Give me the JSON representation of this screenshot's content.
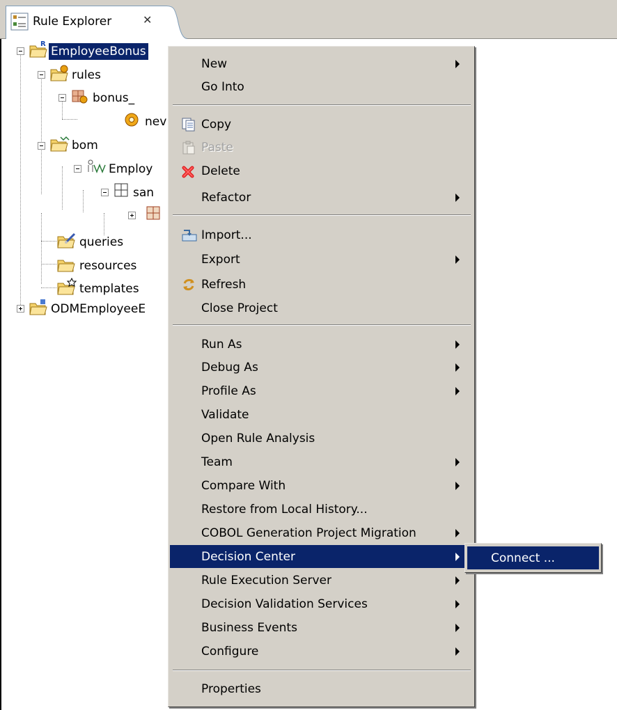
{
  "view": {
    "tab_title": "Rule Explorer",
    "close_glyph": "✕"
  },
  "tree": {
    "nodes": [
      {
        "label": "EmployeeBonus",
        "icon": "rule-project-icon"
      },
      {
        "label": "rules",
        "icon": "rules-folder-icon"
      },
      {
        "label": "bonus_",
        "icon": "ruleflow-package-icon"
      },
      {
        "label": "nev",
        "icon": "rule-gear-icon"
      },
      {
        "label": "bom",
        "icon": "bom-folder-icon"
      },
      {
        "label": "Employ",
        "icon": "bom-entry-icon"
      },
      {
        "label": "san",
        "icon": "package-grid-icon"
      },
      {
        "label": "",
        "icon": "class-grid-icon"
      },
      {
        "label": "queries",
        "icon": "queries-folder-icon"
      },
      {
        "label": "resources",
        "icon": "resources-folder-icon"
      },
      {
        "label": "templates",
        "icon": "templates-folder-icon"
      },
      {
        "label": "ODMEmployeeE",
        "icon": "project-folder-icon"
      }
    ]
  },
  "context_menu": {
    "items": [
      {
        "label": "New",
        "submenu": true
      },
      {
        "label": "Go Into"
      },
      {
        "label": "Copy",
        "icon": "copy-icon"
      },
      {
        "label": "Paste",
        "icon": "paste-icon",
        "disabled": true
      },
      {
        "label": "Delete",
        "icon": "delete-icon"
      },
      {
        "label": "Refactor",
        "submenu": true
      },
      {
        "label": "Import...",
        "icon": "import-icon"
      },
      {
        "label": "Export",
        "submenu": true
      },
      {
        "label": "Refresh",
        "icon": "refresh-icon"
      },
      {
        "label": "Close Project"
      },
      {
        "label": "Run As",
        "submenu": true
      },
      {
        "label": "Debug As",
        "submenu": true
      },
      {
        "label": "Profile As",
        "submenu": true
      },
      {
        "label": "Validate"
      },
      {
        "label": "Open Rule Analysis"
      },
      {
        "label": "Team",
        "submenu": true
      },
      {
        "label": "Compare With",
        "submenu": true
      },
      {
        "label": "Restore from Local History..."
      },
      {
        "label": "COBOL Generation Project Migration",
        "submenu": true
      },
      {
        "label": "Decision Center",
        "submenu": true,
        "highlighted": true
      },
      {
        "label": "Rule Execution Server",
        "submenu": true
      },
      {
        "label": "Decision Validation Services",
        "submenu": true
      },
      {
        "label": "Business Events",
        "submenu": true
      },
      {
        "label": "Configure",
        "submenu": true
      },
      {
        "label": "Properties"
      }
    ]
  },
  "submenu": {
    "items": [
      {
        "label": "Connect ...",
        "highlighted": true
      }
    ]
  },
  "colors": {
    "selection": "#0a246a",
    "menu_bg": "#d4d0c8",
    "delete_red": "#e02020"
  }
}
